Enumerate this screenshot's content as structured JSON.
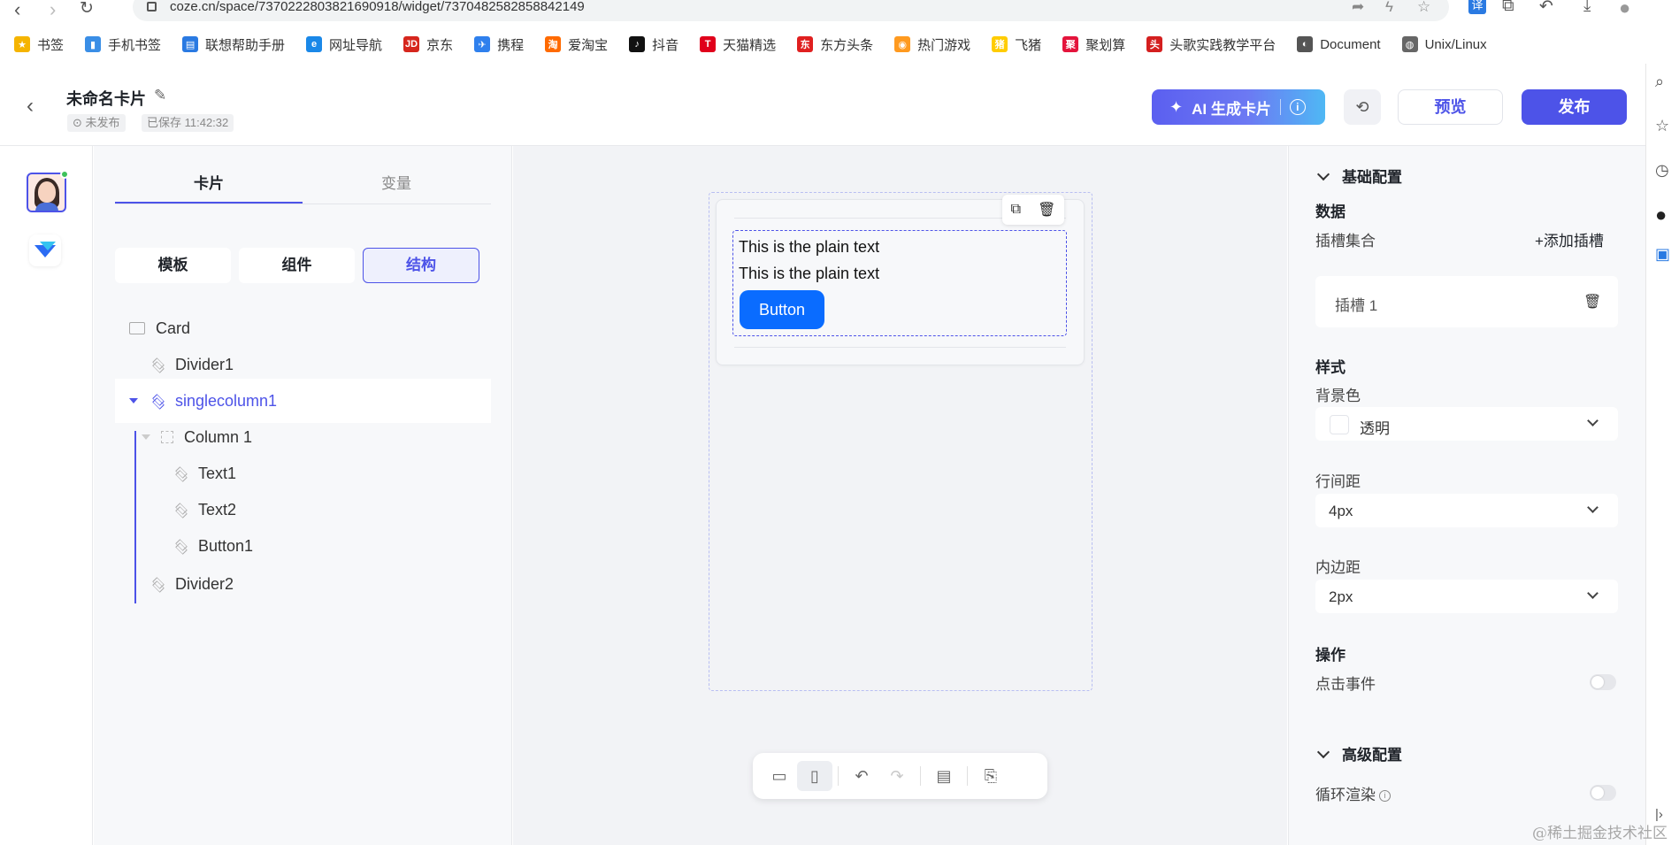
{
  "browser": {
    "url": "coze.cn/space/7370222803821690918/widget/7370482582858842149",
    "bookmarks": [
      {
        "label": "书签",
        "color": "#f5b400",
        "glyph": "★"
      },
      {
        "label": "手机书签",
        "color": "#3a8ee6",
        "glyph": "▮"
      },
      {
        "label": "联想帮助手册",
        "color": "#2a7ae2",
        "glyph": "▤"
      },
      {
        "label": "网址导航",
        "color": "#1a88e8",
        "glyph": "e"
      },
      {
        "label": "京东",
        "color": "#d6261d",
        "glyph": "JD"
      },
      {
        "label": "携程",
        "color": "#2f80ed",
        "glyph": "✈"
      },
      {
        "label": "爱淘宝",
        "color": "#ff6a00",
        "glyph": "淘"
      },
      {
        "label": "抖音",
        "color": "#111111",
        "glyph": "♪"
      },
      {
        "label": "天猫精选",
        "color": "#e0001b",
        "glyph": "T"
      },
      {
        "label": "东方头条",
        "color": "#e02020",
        "glyph": "东"
      },
      {
        "label": "热门游戏",
        "color": "#ff9a1f",
        "glyph": "◉"
      },
      {
        "label": "飞猪",
        "color": "#ffcc00",
        "glyph": "猪"
      },
      {
        "label": "聚划算",
        "color": "#e4143c",
        "glyph": "聚"
      },
      {
        "label": "头歌实践教学平台",
        "color": "#d41f1f",
        "glyph": "头"
      },
      {
        "label": "Document",
        "color": "#555555",
        "glyph": "◐"
      },
      {
        "label": "Unix/Linux",
        "color": "#666666",
        "glyph": "◍"
      }
    ]
  },
  "header": {
    "title": "未命名卡片",
    "status_tag": "未发布",
    "saved_tag": "已保存 11:42:32",
    "ai_button": "AI 生成卡片",
    "preview_button": "预览",
    "publish_button": "发布"
  },
  "left_panel": {
    "tabs": [
      "卡片",
      "变量"
    ],
    "segments": [
      "模板",
      "组件",
      "结构"
    ],
    "tree": [
      "Card",
      "Divider1",
      "singlecolumn1",
      "Column 1",
      "Text1",
      "Text2",
      "Button1",
      "Divider2"
    ]
  },
  "canvas": {
    "text1": "This is the plain text",
    "text2": "This is the plain text",
    "button": "Button"
  },
  "right_panel": {
    "basic_config": "基础配置",
    "data_heading": "数据",
    "slot_collection": "插槽集合",
    "add_slot": "+添加插槽",
    "slot_name": "插槽 1",
    "style_heading": "样式",
    "bg_label": "背景色",
    "bg_value": "透明",
    "row_gap_label": "行间距",
    "row_gap_value": "4px",
    "padding_label": "内边距",
    "padding_value": "2px",
    "action_heading": "操作",
    "click_event": "点击事件",
    "advanced_config": "高级配置",
    "loop_render": "循环渲染"
  },
  "watermark": "@稀土掘金技术社区",
  "colors": {
    "accent": "#4d53e8",
    "button_blue": "#0a6cff"
  }
}
